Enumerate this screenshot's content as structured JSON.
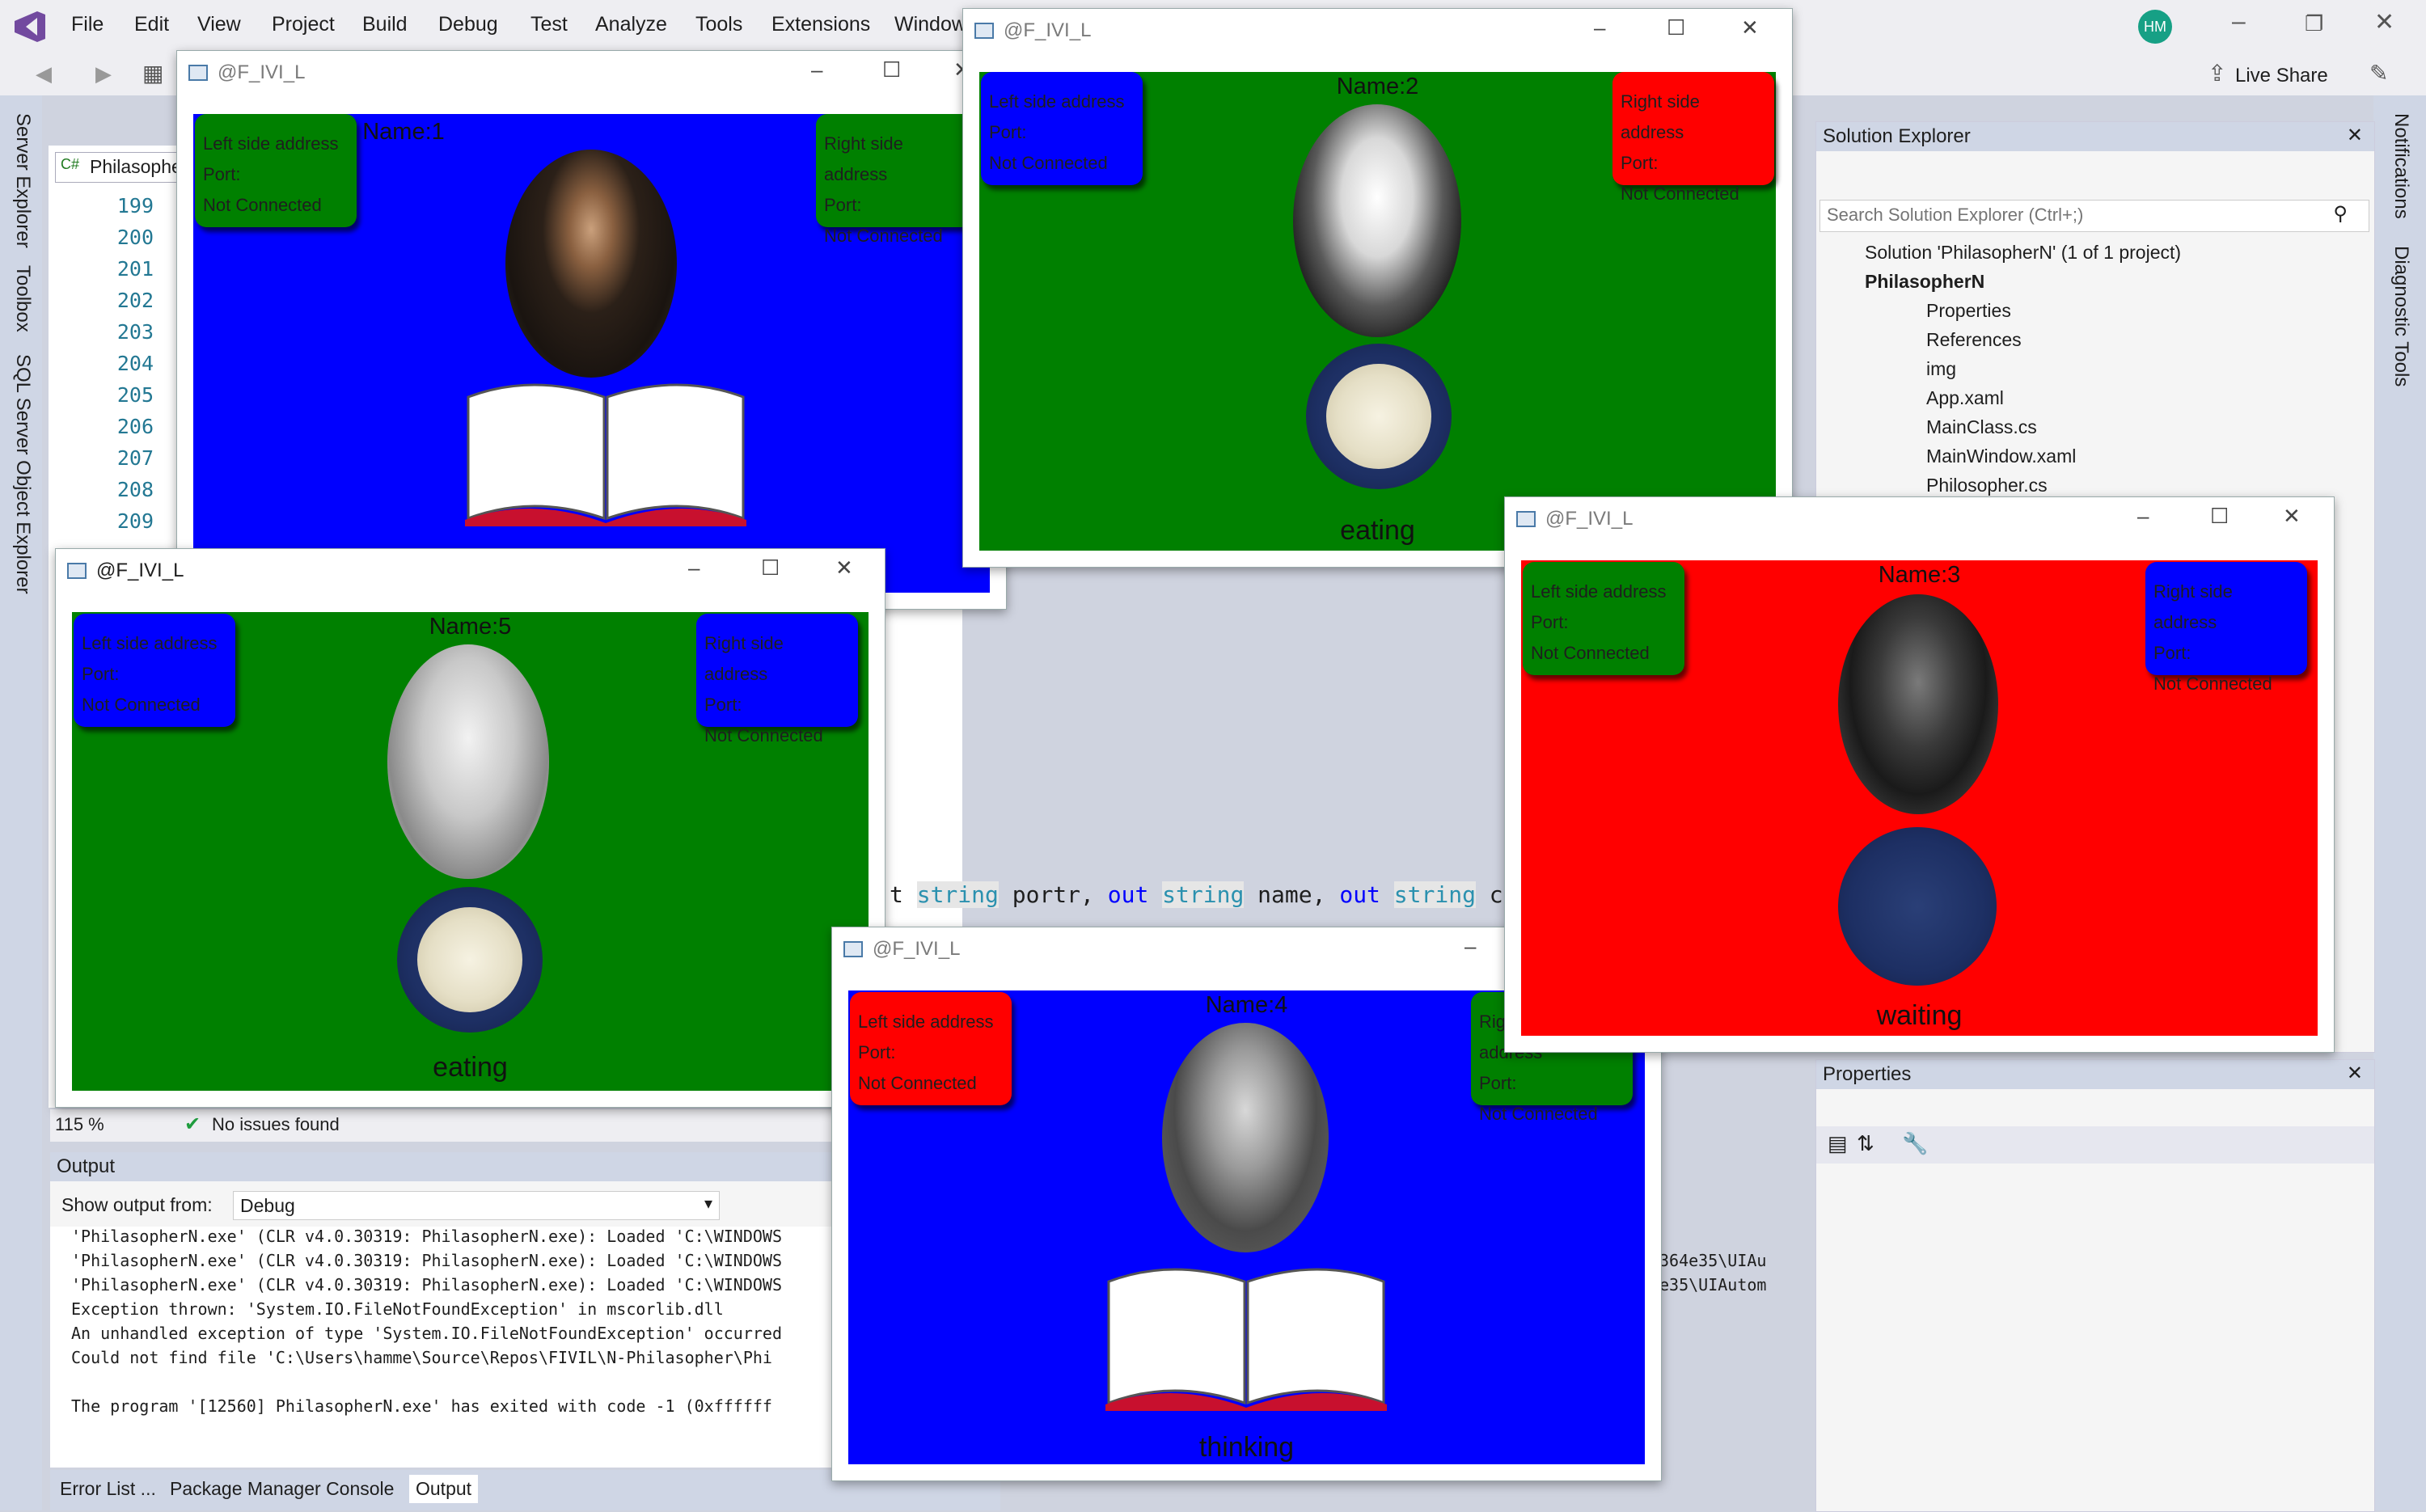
{
  "vs": {
    "menu": [
      "File",
      "Edit",
      "View",
      "Project",
      "Build",
      "Debug",
      "Test",
      "Analyze",
      "Tools",
      "Extensions",
      "Window"
    ],
    "avatar": "HM",
    "live_share": "Live Share",
    "left_tabs": [
      "Server Explorer",
      "Toolbox",
      "SQL Server Object Explorer"
    ],
    "right_tabs": [
      "Notifications",
      "Diagnostic Tools"
    ],
    "editor_tab": "Philasophe",
    "line_numbers": [
      "199",
      "200",
      "201",
      "202",
      "203",
      "204",
      "205",
      "206",
      "207",
      "208",
      "209"
    ],
    "code": {
      "p1": "t ",
      "k1": "string",
      "p2": " portr, ",
      "k2": "out",
      "p3": " ",
      "k3": "string",
      "p4": " name, ",
      "k4": "out",
      "p5": " ",
      "k5": "string",
      "p6": " cou"
    },
    "zoom": "115 %",
    "issues": "No issues found"
  },
  "solution_explorer": {
    "title": "Solution Explorer",
    "search_placeholder": "Search Solution Explorer (Ctrl+;)",
    "solution": "Solution 'PhilasopherN' (1 of 1 project)",
    "project": "PhilasopherN",
    "items": [
      "Properties",
      "References",
      "img",
      "App.xaml",
      "MainClass.cs",
      "MainWindow.xaml",
      "Philosopher.cs"
    ]
  },
  "properties": {
    "title": "Properties"
  },
  "output": {
    "title": "Output",
    "show_from_label": "Show output from:",
    "source": "Debug",
    "lines": [
      "'PhilasopherN.exe' (CLR v4.0.30319: PhilasopherN.exe): Loaded 'C:\\WINDOWS",
      "'PhilasopherN.exe' (CLR v4.0.30319: PhilasopherN.exe): Loaded 'C:\\WINDOWS",
      "'PhilasopherN.exe' (CLR v4.0.30319: PhilasopherN.exe): Loaded 'C:\\WINDOWS",
      "Exception thrown: 'System.IO.FileNotFoundException' in mscorlib.dll",
      "An unhandled exception of type 'System.IO.FileNotFoundException' occurred",
      "Could not find file 'C:\\Users\\hamme\\Source\\Repos\\FIVIL\\N-Philasopher\\Phi",
      "",
      "The program '[12560] PhilasopherN.exe' has exited with code -1 (0xffffff"
    ],
    "right_fragments": [
      "364e35\\UIAu",
      "e35\\UIAutom"
    ]
  },
  "bottom_tabs": [
    "Error List ...",
    "Package Manager Console",
    "Output"
  ],
  "windows": [
    {
      "title": "@F_IVI_L",
      "name": "Name:1",
      "state": "",
      "left_label": "Left side address",
      "right_label": "Right side address",
      "port": "Port:",
      "conn": "Not Connected",
      "bg": "#0000ff",
      "left_color": "#008000",
      "right_color": "#008000",
      "item": "book"
    },
    {
      "title": "@F_IVI_L",
      "name": "Name:2",
      "state": "eating",
      "left_label": "Left side address",
      "right_label": "Right side address",
      "port": "Port:",
      "conn": "Not Connected",
      "bg": "#008000",
      "left_color": "#0000ff",
      "right_color": "#ff0000",
      "item": "noodles"
    },
    {
      "title": "@F_IVI_L",
      "name": "Name:3",
      "state": "waiting",
      "left_label": "Left side address",
      "right_label": "Right side address",
      "port": "Port:",
      "conn": "Not Connected",
      "bg": "#ff0000",
      "left_color": "#008000",
      "right_color": "#0000ff",
      "item": "plate"
    },
    {
      "title": "@F_IVI_L",
      "name": "Name:4",
      "state": "thinking",
      "left_label": "Left side address",
      "right_label": "Right side address",
      "port": "Port:",
      "conn": "Not Connected",
      "bg": "#0000ff",
      "left_color": "#ff0000",
      "right_color": "#008000",
      "item": "book"
    },
    {
      "title": "@F_IVI_L",
      "name": "Name:5",
      "state": "eating",
      "left_label": "Left side address",
      "right_label": "Right side address",
      "port": "Port:",
      "conn": "Not Connected",
      "bg": "#008000",
      "left_color": "#0000ff",
      "right_color": "#0000ff",
      "item": "noodles"
    }
  ]
}
